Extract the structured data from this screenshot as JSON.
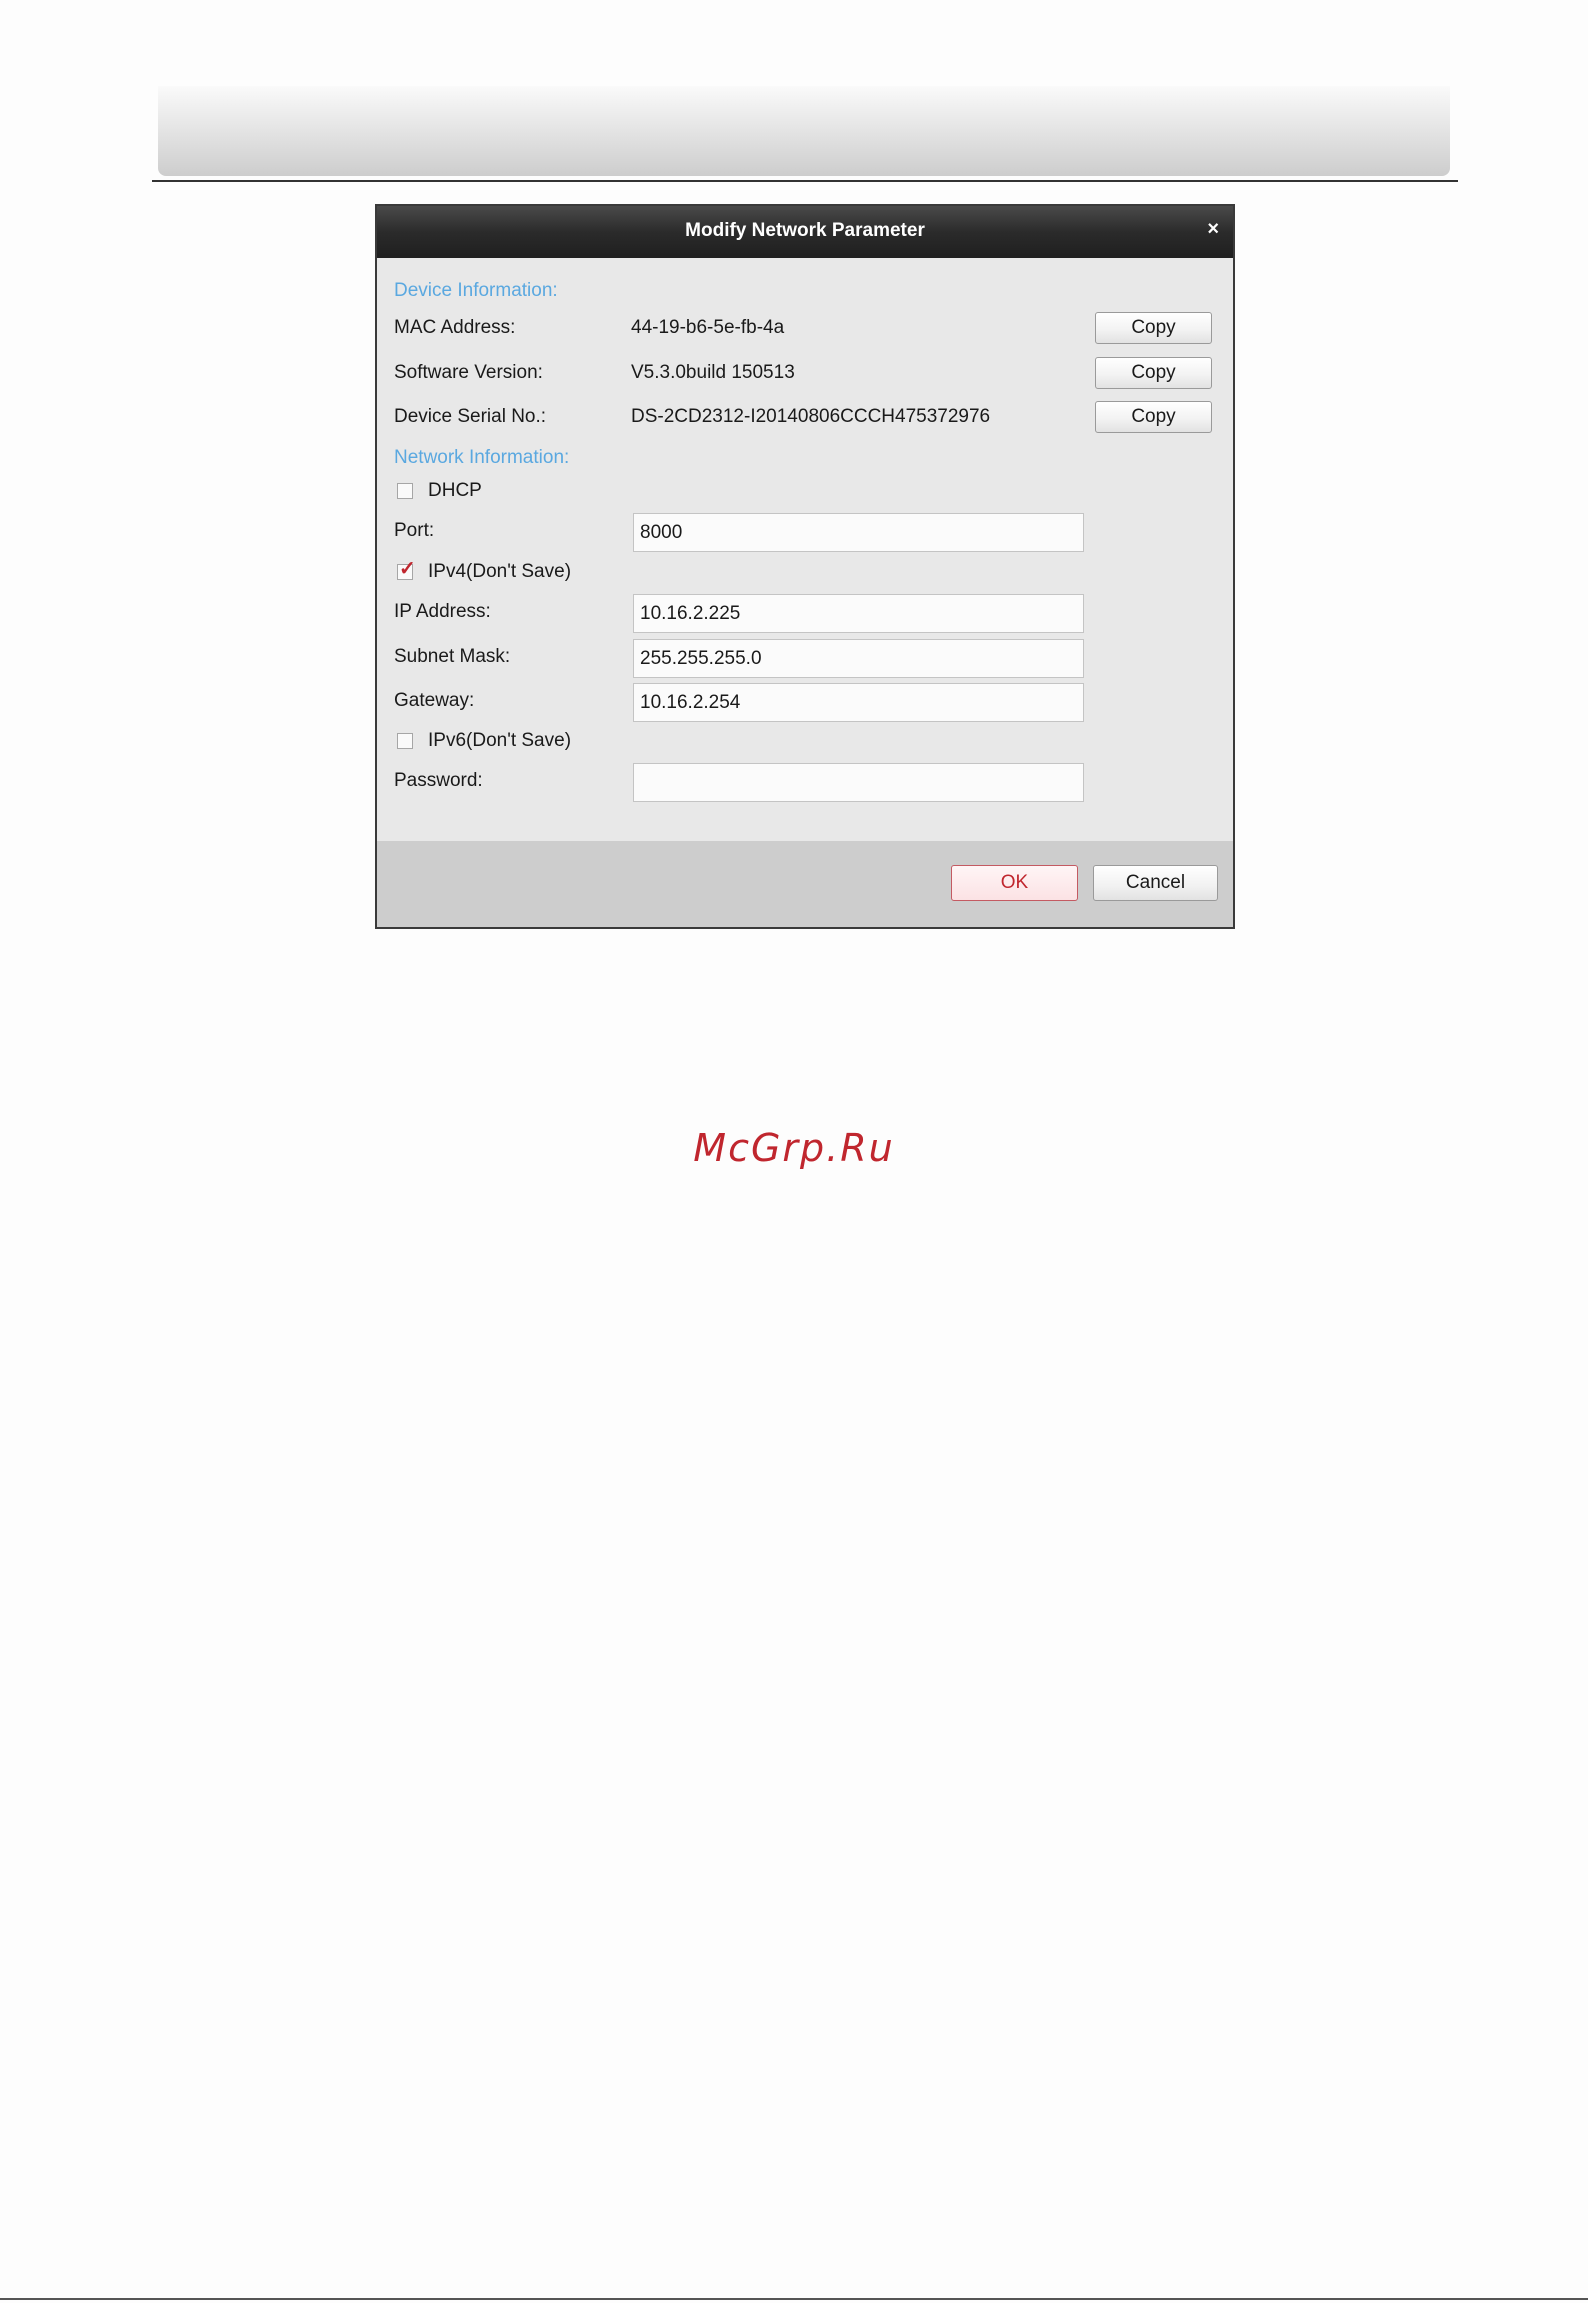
{
  "dialog": {
    "title": "Modify Network Parameter",
    "close_glyph": "×",
    "device_info_heading": "Device Information:",
    "network_info_heading": "Network Information:",
    "device_rows": [
      {
        "label": "MAC Address:",
        "value": "44-19-b6-5e-fb-4a",
        "button": "Copy"
      },
      {
        "label": "Software Version:",
        "value": "V5.3.0build 150513",
        "button": "Copy"
      },
      {
        "label": "Device Serial No.:",
        "value": "DS-2CD2312-I20140806CCCH475372976",
        "button": "Copy"
      }
    ],
    "dhcp": {
      "label": "DHCP",
      "checked": false
    },
    "port": {
      "label": "Port:",
      "value": "8000"
    },
    "ipv4": {
      "label": "IPv4(Don't Save)",
      "checked": true
    },
    "ip_address": {
      "label": "IP Address:",
      "value": "10.16.2.225"
    },
    "subnet_mask": {
      "label": "Subnet Mask:",
      "value": "255.255.255.0"
    },
    "gateway": {
      "label": "Gateway:",
      "value": "10.16.2.254"
    },
    "ipv6": {
      "label": "IPv6(Don't Save)",
      "checked": false
    },
    "password": {
      "label": "Password:",
      "value": ""
    },
    "ok_label": "OK",
    "cancel_label": "Cancel"
  },
  "watermark": "McGrp.Ru",
  "colors": {
    "section_heading": "#5aa8e0",
    "accent_red": "#c0262e",
    "titlebar": "#2b2b2b"
  }
}
